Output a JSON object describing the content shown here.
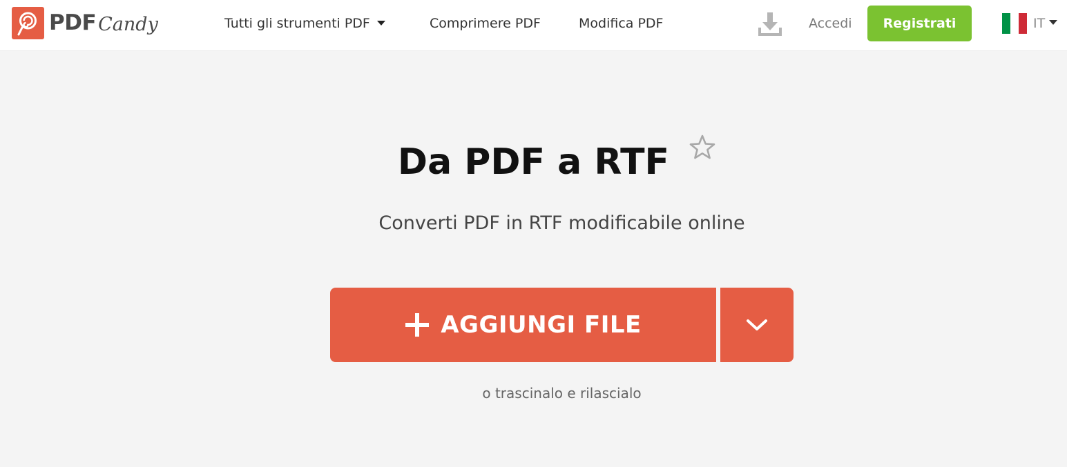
{
  "header": {
    "logo": {
      "primary": "PDF",
      "secondary": "Candy",
      "icon": "lollipop-icon",
      "color": "#e55d44"
    },
    "nav": {
      "tools_label": "Tutti gli strumenti PDF",
      "compress_label": "Comprimere PDF",
      "edit_label": "Modifica PDF"
    },
    "download_icon": "download-icon",
    "login_label": "Accedi",
    "register_label": "Registrati",
    "register_color": "#7bc231",
    "language": {
      "code": "IT",
      "flag": "italy-flag",
      "flag_colors": [
        "#009246",
        "#ffffff",
        "#ce2b37"
      ]
    }
  },
  "main": {
    "title": "Da PDF a RTF",
    "favorite_icon": "star-icon",
    "subtitle": "Converti PDF in RTF modificabile online",
    "add_button_label": "AGGIUNGI FILE",
    "add_button_color": "#e55d44",
    "drop_hint": "o trascinalo e rilascialo"
  }
}
